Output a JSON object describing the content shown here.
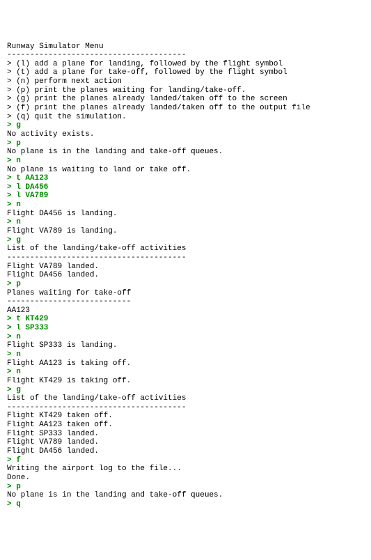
{
  "lines": [
    {
      "text": "Runway Simulator Menu",
      "cls": ""
    },
    {
      "text": "---------------------------------------",
      "cls": ""
    },
    {
      "text": "> (l) add a plane for landing, followed by the flight symbol",
      "cls": ""
    },
    {
      "text": "> (t) add a plane for take-off, followed by the flight symbol",
      "cls": ""
    },
    {
      "text": "> (n) perform next action",
      "cls": ""
    },
    {
      "text": "> (p) print the planes waiting for landing/take-off.",
      "cls": ""
    },
    {
      "text": "> (g) print the planes already landed/taken off to the screen",
      "cls": ""
    },
    {
      "text": "> (f) print the planes already landed/taken off to the output file",
      "cls": ""
    },
    {
      "text": "> (q) quit the simulation.",
      "cls": ""
    },
    {
      "text": "",
      "cls": ""
    },
    {
      "text": "> g",
      "cls": "green"
    },
    {
      "text": "No activity exists.",
      "cls": ""
    },
    {
      "text": "> p",
      "cls": "green"
    },
    {
      "text": "No plane is in the landing and take-off queues.",
      "cls": ""
    },
    {
      "text": "> n",
      "cls": "green"
    },
    {
      "text": "No plane is waiting to land or take off.",
      "cls": ""
    },
    {
      "text": "> t AA123",
      "cls": "green"
    },
    {
      "text": "> l DA456",
      "cls": "green"
    },
    {
      "text": "> l VA789",
      "cls": "green"
    },
    {
      "text": "> n",
      "cls": "green"
    },
    {
      "text": "Flight DA456 is landing.",
      "cls": ""
    },
    {
      "text": "> n",
      "cls": "green"
    },
    {
      "text": "Flight VA789 is landing.",
      "cls": ""
    },
    {
      "text": "> g",
      "cls": "green"
    },
    {
      "text": "List of the landing/take-off activities",
      "cls": ""
    },
    {
      "text": "---------------------------------------",
      "cls": ""
    },
    {
      "text": "Flight VA789 landed.",
      "cls": ""
    },
    {
      "text": "Flight DA456 landed.",
      "cls": ""
    },
    {
      "text": "",
      "cls": ""
    },
    {
      "text": "> p",
      "cls": "green"
    },
    {
      "text": "Planes waiting for take-off",
      "cls": ""
    },
    {
      "text": "---------------------------",
      "cls": ""
    },
    {
      "text": "AA123",
      "cls": ""
    },
    {
      "text": "",
      "cls": ""
    },
    {
      "text": "> t KT429",
      "cls": "green"
    },
    {
      "text": "> l SP333",
      "cls": "green"
    },
    {
      "text": "> n",
      "cls": "green"
    },
    {
      "text": "Flight SP333 is landing.",
      "cls": ""
    },
    {
      "text": "> n",
      "cls": "green"
    },
    {
      "text": "Flight AA123 is taking off.",
      "cls": ""
    },
    {
      "text": "> n",
      "cls": "green"
    },
    {
      "text": "Flight KT429 is taking off.",
      "cls": ""
    },
    {
      "text": "> g",
      "cls": "green"
    },
    {
      "text": "List of the landing/take-off activities",
      "cls": ""
    },
    {
      "text": "---------------------------------------",
      "cls": ""
    },
    {
      "text": "Flight KT429 taken off.",
      "cls": ""
    },
    {
      "text": "Flight AA123 taken off.",
      "cls": ""
    },
    {
      "text": "Flight SP333 landed.",
      "cls": ""
    },
    {
      "text": "Flight VA789 landed.",
      "cls": ""
    },
    {
      "text": "Flight DA456 landed.",
      "cls": ""
    },
    {
      "text": "",
      "cls": ""
    },
    {
      "text": "> f",
      "cls": "green"
    },
    {
      "text": "Writing the airport log to the file...",
      "cls": ""
    },
    {
      "text": "Done.",
      "cls": ""
    },
    {
      "text": "> p",
      "cls": "green"
    },
    {
      "text": "No plane is in the landing and take-off queues.",
      "cls": ""
    },
    {
      "text": "> q",
      "cls": "green"
    }
  ]
}
